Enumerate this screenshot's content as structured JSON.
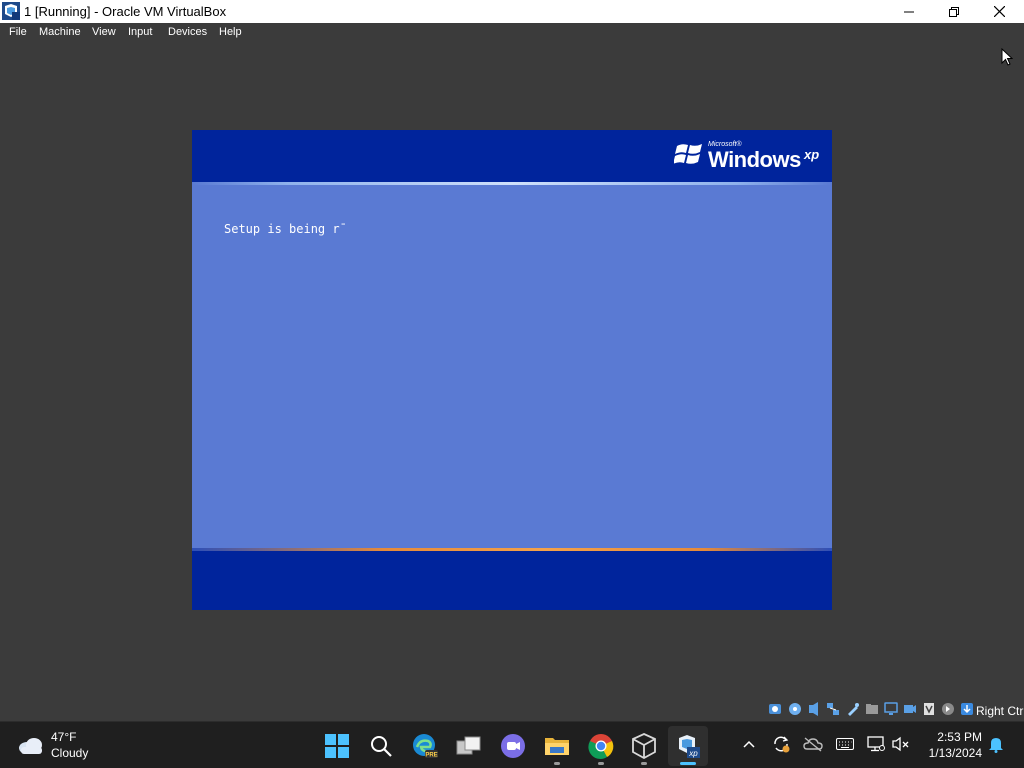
{
  "window": {
    "title": "1 [Running] - Oracle VM VirtualBox",
    "app_icon": "virtualbox-xp-icon",
    "controls": [
      "minimize-icon",
      "restore-icon",
      "close-icon"
    ]
  },
  "menu": {
    "items": [
      "File",
      "Machine",
      "View",
      "Input",
      "Devices",
      "Help"
    ]
  },
  "guest": {
    "logo_small": "Microsoft®",
    "logo_main": "Windows",
    "logo_sup": "xp",
    "message": "Setup is being r¯",
    "colors": {
      "header": "#00249c",
      "body": "#5a7ad3",
      "footer": "#00249c"
    }
  },
  "vbox_status": {
    "icons": [
      "hard-disk-icon",
      "optical-disk-icon",
      "audio-icon",
      "network-icon",
      "usb-icon",
      "shared-folders-icon",
      "display-icon",
      "recording-icon",
      "cpu-virtualization-icon",
      "mouse-integration-icon",
      "keyboard-capture-icon"
    ],
    "host_key": "Right Ctrl"
  },
  "taskbar": {
    "weather": {
      "temp": "47°F",
      "condition": "Cloudy",
      "icon": "cloud-icon"
    },
    "apps": [
      {
        "name": "start",
        "icon": "windows-start-icon"
      },
      {
        "name": "search",
        "icon": "search-icon"
      },
      {
        "name": "edge-dev",
        "icon": "edge-pre-icon",
        "badge": "PRE"
      },
      {
        "name": "task-view",
        "icon": "task-view-icon"
      },
      {
        "name": "teams",
        "icon": "teams-chat-icon"
      },
      {
        "name": "file-explorer",
        "icon": "folder-icon"
      },
      {
        "name": "chrome",
        "icon": "chrome-icon"
      },
      {
        "name": "virtualbox",
        "icon": "virtualbox-icon"
      },
      {
        "name": "vm-window",
        "icon": "virtualbox-xp-icon",
        "badge": "xp"
      }
    ],
    "tray": [
      "chevron-up-icon",
      "sync-icon",
      "onedrive-offline-icon",
      "keyboard-icon",
      "network-icon",
      "volume-muted-icon"
    ],
    "clock": {
      "time": "2:53 PM",
      "date": "1/13/2024"
    },
    "notification_icon": "bell-icon",
    "colors": {
      "accent": "#4cc2ff"
    }
  }
}
